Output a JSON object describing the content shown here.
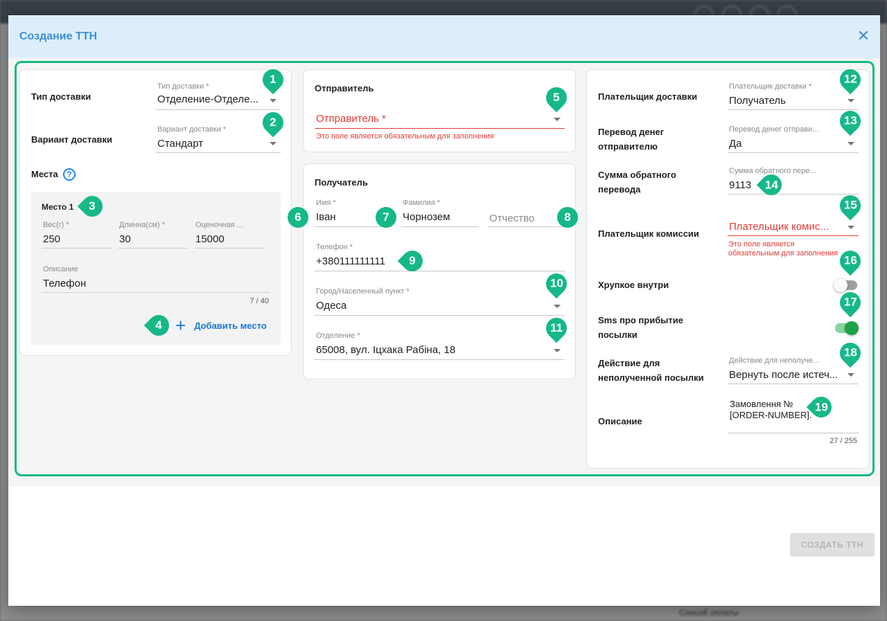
{
  "background": {
    "bottom_label": "Способ оплаты"
  },
  "dialog": {
    "title": "Создание ТТН",
    "close_icon": "close-icon",
    "create_button": "СОЗДАТЬ ТТН"
  },
  "delivery": {
    "type_row_label": "Тип доставки",
    "type_field_label": "Тип доставки *",
    "type_value": "Отделение-Отделе...",
    "variant_row_label": "Вариант доставки",
    "variant_field_label": "Вариант доставки *",
    "variant_value": "Стандарт",
    "places_label": "Места",
    "help_icon": "?",
    "place": {
      "title": "Место 1",
      "weight_label": "Вес(г) *",
      "weight_value": "250",
      "length_label": "Длинна(см) *",
      "length_value": "30",
      "estimated_label": "Оценочная ...",
      "estimated_value": "15000",
      "description_label": "Описание",
      "description_value": "Телефон",
      "counter": "7 / 40"
    },
    "add_place_label": "Добавить место"
  },
  "sender": {
    "title": "Отправитель",
    "field_placeholder": "Отправитель *",
    "error": "Это поле является обязательным для заполнения"
  },
  "recipient": {
    "title": "Получатель",
    "first_name_label": "Имя *",
    "first_name_value": "Іван",
    "last_name_label": "Фамилия *",
    "last_name_value": "Чорнозем",
    "middle_name_placeholder": "Отчество",
    "phone_label": "Телефон *",
    "phone_value": "+380111111111",
    "city_label": "Город/Населенный пункт *",
    "city_value": "Одеса",
    "branch_label": "Отделение *",
    "branch_value": "65008, вул. Іцхака Рабіна, 18"
  },
  "payment": {
    "payer_row_label": "Плательщик доставки",
    "payer_field_label": "Плательщик доставки *",
    "payer_value": "Получатель",
    "transfer_row_label": "Перевод денег отправителю",
    "transfer_field_label": "Перевод денег отправи...",
    "transfer_value": "Да",
    "sum_row_label": "Сумма обратного перевода",
    "sum_field_label": "Сумма обратного пере...",
    "sum_value": "9113",
    "commission_row_label": "Плательщик комиссии",
    "commission_placeholder": "Плательщик комис...",
    "commission_error": "Это поле является обязательным для заполнения",
    "fragile_label": "Хрупкое внутри",
    "fragile_on": false,
    "sms_label": "Sms про прибытие посылки",
    "sms_on": true,
    "action_row_label": "Действие для неполученной посылки",
    "action_field_label": "Действие для неполуче...",
    "action_value": "Вернуть после истеч...",
    "description_row_label": "Описание",
    "description_value": "Замовлення № [ORDER-NUMBER].",
    "description_counter": "27 / 255"
  },
  "markers": [
    "1",
    "2",
    "3",
    "4",
    "5",
    "6",
    "7",
    "8",
    "9",
    "10",
    "11",
    "12",
    "13",
    "14",
    "15",
    "16",
    "17",
    "18",
    "19"
  ],
  "colors": {
    "accent": "#16b889",
    "title_blue": "#3b8fd6",
    "link_blue": "#1976d2",
    "error_red": "#e53935",
    "toggle_on": "#1aa34a"
  }
}
